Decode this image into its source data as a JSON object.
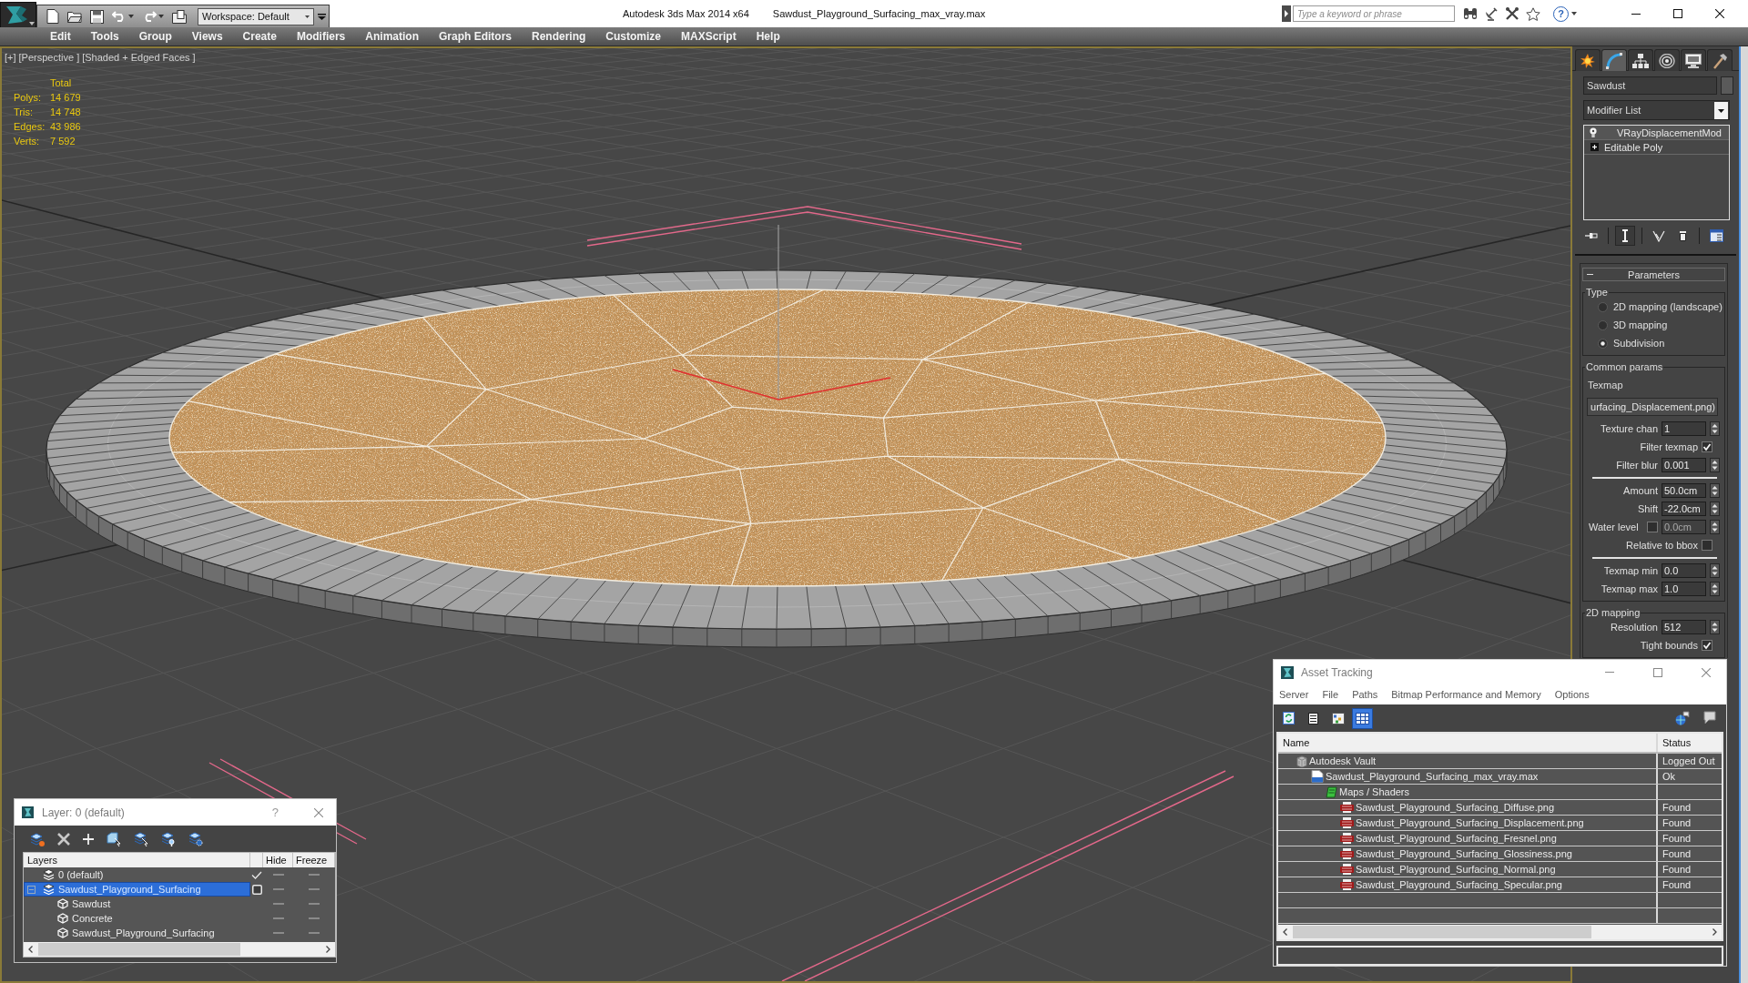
{
  "title_bar": {
    "workspace": "Workspace: Default",
    "app_title": "Autodesk 3ds Max 2014 x64",
    "document": "Sawdust_Playground_Surfacing_max_vray.max",
    "search": {
      "placeholder": "Type a keyword or phrase"
    },
    "help": "?"
  },
  "menu_bar": [
    "Edit",
    "Tools",
    "Group",
    "Views",
    "Create",
    "Modifiers",
    "Animation",
    "Graph Editors",
    "Rendering",
    "Customize",
    "MAXScript",
    "Help"
  ],
  "viewport": {
    "labels": [
      "[+]",
      "[Perspective ]",
      "[Shaded + Edged Faces ]"
    ],
    "stats": {
      "header": "Total",
      "rows": [
        {
          "label": "Polys:",
          "value": "14 679"
        },
        {
          "label": "Tris:",
          "value": "14 748"
        },
        {
          "label": "Edges:",
          "value": "43 986"
        },
        {
          "label": "Verts:",
          "value": "7 592"
        }
      ]
    }
  },
  "command_panel": {
    "tabs": [
      {
        "kind": "create",
        "selected": false
      },
      {
        "kind": "modify",
        "selected": true
      },
      {
        "kind": "hierarchy",
        "selected": false
      },
      {
        "kind": "motion",
        "selected": false
      },
      {
        "kind": "display",
        "selected": false
      },
      {
        "kind": "utilities",
        "selected": false
      }
    ],
    "object_name": "Sawdust",
    "modifier_list": "Modifier List",
    "stack": [
      {
        "kind": "modifier",
        "name": "VRayDisplacementMod"
      },
      {
        "kind": "base",
        "name": "Editable Poly",
        "expanded": false
      }
    ],
    "stack_tools": [
      {
        "kind": "pin",
        "on": false
      },
      {
        "kind": "end_result",
        "on": true
      },
      {
        "kind": "make_unique",
        "on": false
      },
      {
        "kind": "remove",
        "on": false
      },
      {
        "kind": "configure",
        "on": false
      }
    ],
    "rollout": {
      "title": "Parameters",
      "expanded": true,
      "groups": [
        {
          "kind": "radios",
          "label": "Type",
          "options": [
            {
              "label": "2D mapping (landscape)",
              "selected": false
            },
            {
              "label": "3D mapping",
              "selected": false
            },
            {
              "label": "Subdivision",
              "selected": true
            }
          ]
        },
        {
          "kind": "fields",
          "label": "Common params",
          "fields": [
            {
              "kind": "caption",
              "label": "Texmap"
            },
            {
              "kind": "map_button",
              "value": "urfacing_Displacement.png)"
            },
            {
              "kind": "spinner",
              "label": "Texture chan",
              "value": "1",
              "disabled": false
            },
            {
              "kind": "checkbox",
              "label": "Filter texmap",
              "checked": true,
              "disabled": false
            },
            {
              "kind": "spinner",
              "label": "Filter blur",
              "value": "0.001",
              "disabled": false
            },
            {
              "kind": "separator"
            },
            {
              "kind": "spinner",
              "label": "Amount",
              "value": "50.0cm",
              "disabled": false
            },
            {
              "kind": "spinner",
              "label": "Shift",
              "value": "-22.0cm",
              "disabled": false
            },
            {
              "kind": "checkbox_spinner",
              "label": "Water level",
              "checked": false,
              "value": "0.0cm",
              "disabled": true
            },
            {
              "kind": "checkbox",
              "label": "Relative to bbox",
              "checked": false,
              "disabled": false
            },
            {
              "kind": "separator"
            },
            {
              "kind": "spinner",
              "label": "Texmap min",
              "value": "0.0",
              "disabled": false
            },
            {
              "kind": "spinner",
              "label": "Texmap max",
              "value": "1.0",
              "disabled": false
            }
          ]
        },
        {
          "kind": "fields",
          "label": "2D mapping",
          "fields": [
            {
              "kind": "spinner",
              "label": "Resolution",
              "value": "512",
              "disabled": false
            },
            {
              "kind": "checkbox",
              "label": "Tight bounds",
              "checked": true,
              "disabled": false
            }
          ]
        }
      ]
    }
  },
  "layer_dialog": {
    "title": "Layer: 0 (default)",
    "help": "?",
    "columns": [
      "Layers",
      "Hide",
      "Freeze"
    ],
    "rows": [
      {
        "kind": "layer",
        "name": "0 (default)",
        "current": true,
        "selected": false,
        "hidden": false,
        "frozen": false
      },
      {
        "kind": "layer",
        "name": "Sawdust_Playground_Surfacing",
        "current": false,
        "selected": true,
        "expanded": true,
        "hidden": false,
        "frozen": false,
        "children": [
          {
            "kind": "object",
            "name": "Sawdust",
            "selected": false,
            "hidden": false,
            "frozen": false
          },
          {
            "kind": "object",
            "name": "Concrete",
            "selected": false,
            "hidden": false,
            "frozen": false
          },
          {
            "kind": "object",
            "name": "Sawdust_Playground_Surfacing",
            "selected": false,
            "hidden": false,
            "frozen": false
          }
        ]
      }
    ]
  },
  "asset_tracking": {
    "title": "Asset Tracking",
    "menu": [
      "Server",
      "File",
      "Paths",
      "Bitmap Performance and Memory",
      "Options"
    ],
    "toolbar": [
      {
        "kind": "refresh",
        "selected": false
      },
      {
        "kind": "list",
        "selected": false
      },
      {
        "kind": "tree",
        "selected": false
      },
      {
        "kind": "table",
        "selected": true
      }
    ],
    "columns": [
      "Name",
      "Status"
    ],
    "rows": [
      {
        "kind": "vault",
        "name": "Autodesk Vault",
        "status": "Logged Out",
        "children": [
          {
            "kind": "max",
            "name": "Sawdust_Playground_Surfacing_max_vray.max",
            "status": "Ok",
            "children": [
              {
                "kind": "folder",
                "name": "Maps / Shaders",
                "children": [
                  {
                    "kind": "png",
                    "name": "Sawdust_Playground_Surfacing_Diffuse.png",
                    "status": "Found"
                  },
                  {
                    "kind": "png",
                    "name": "Sawdust_Playground_Surfacing_Displacement.png",
                    "status": "Found"
                  },
                  {
                    "kind": "png",
                    "name": "Sawdust_Playground_Surfacing_Fresnel.png",
                    "status": "Found"
                  },
                  {
                    "kind": "png",
                    "name": "Sawdust_Playground_Surfacing_Glossiness.png",
                    "status": "Found"
                  },
                  {
                    "kind": "png",
                    "name": "Sawdust_Playground_Surfacing_Normal.png",
                    "status": "Found"
                  },
                  {
                    "kind": "png",
                    "name": "Sawdust_Playground_Surfacing_Specular.png",
                    "status": "Found"
                  }
                ]
              }
            ]
          }
        ]
      }
    ]
  }
}
